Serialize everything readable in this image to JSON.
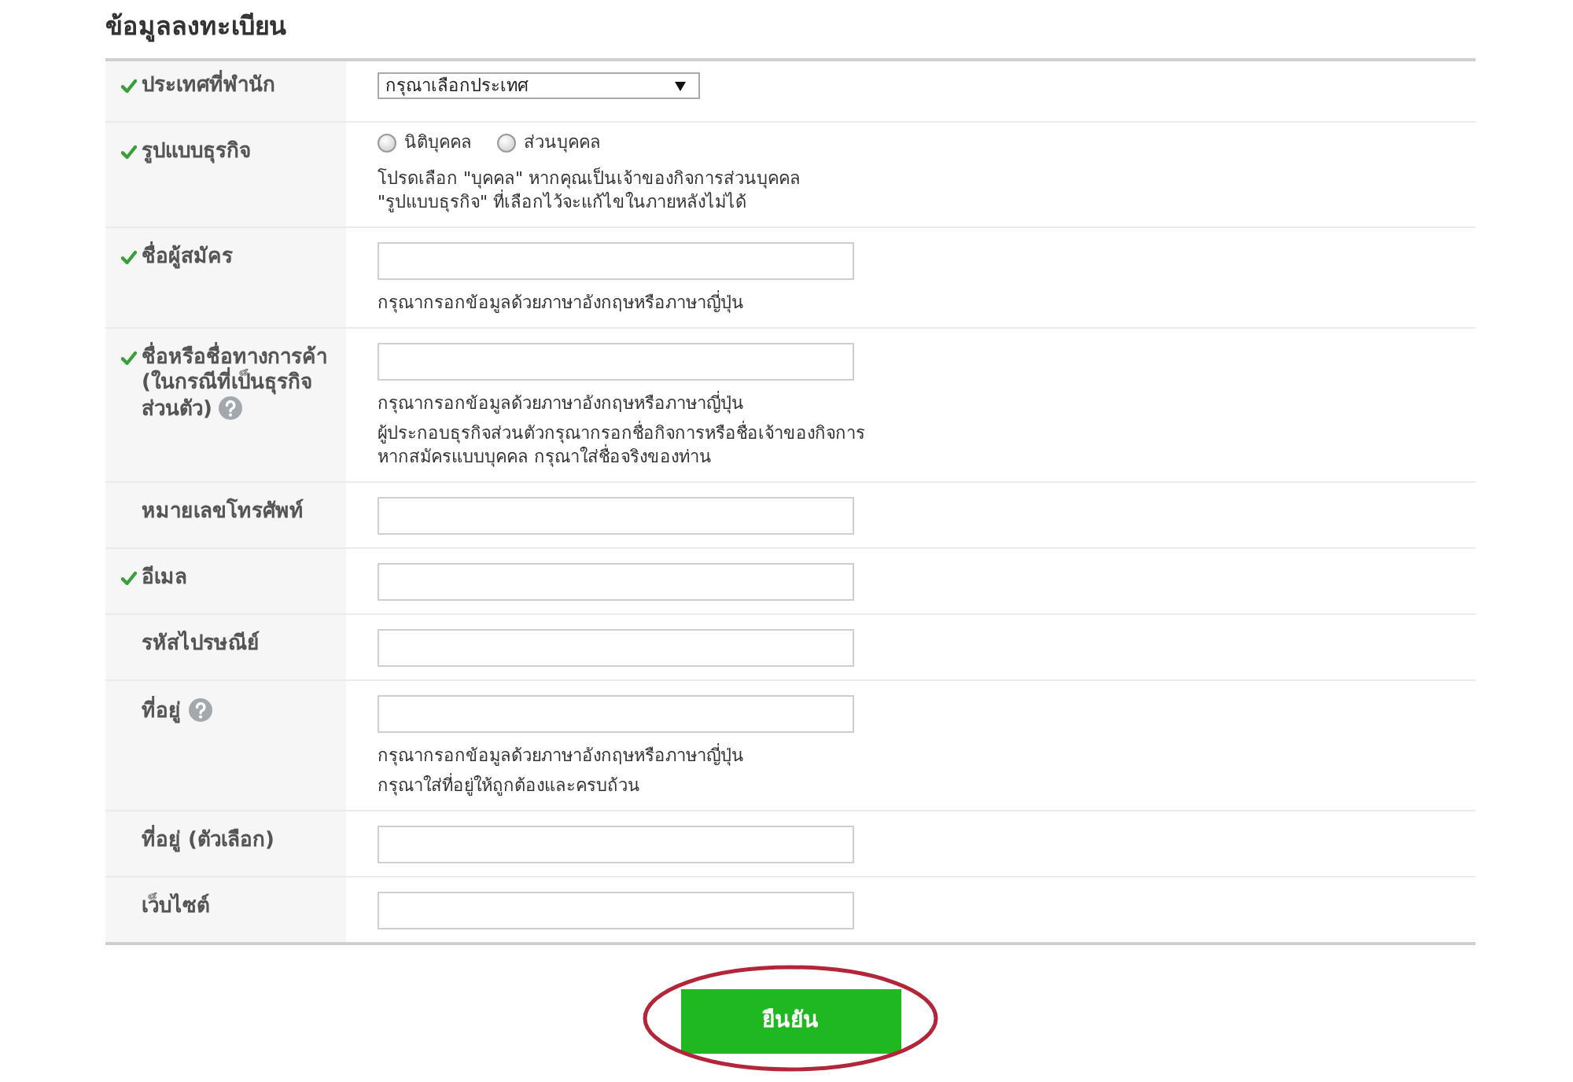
{
  "title": "ข้อมูลลงทะเบียน",
  "fields": [
    {
      "kind": "select",
      "label": "ประเทศที่พำนัก",
      "required": true,
      "help": false,
      "value": "กรุณาเลือกประเทศ"
    },
    {
      "kind": "radio",
      "label": "รูปแบบธุรกิจ",
      "required": true,
      "help": false,
      "options": [
        {
          "label": "นิติบุคคล",
          "selected": false
        },
        {
          "label": "ส่วนบุคคล",
          "selected": false
        }
      ],
      "notes": [
        [
          "โปรดเลือก \"บุคคล\" หากคุณเป็นเจ้าของกิจการส่วนบุคคล",
          "\"รูปแบบธุรกิจ\" ที่เลือกไว้จะแก้ไขในภายหลังไม่ได้"
        ]
      ]
    },
    {
      "kind": "text",
      "label": "ชื่อผู้สมัคร",
      "required": true,
      "help": false,
      "notes": [
        [
          "กรุณากรอกข้อมูลด้วยภาษาอังกฤษหรือภาษาญี่ปุ่น"
        ]
      ]
    },
    {
      "kind": "text",
      "label": "ชื่อหรือชื่อทางการค้า (ในกรณีที่เป็นธุรกิจส่วนตัว)",
      "required": true,
      "help": true,
      "notes": [
        [
          "กรุณากรอกข้อมูลด้วยภาษาอังกฤษหรือภาษาญี่ปุ่น"
        ],
        [
          "ผู้ประกอบธุรกิจส่วนตัวกรุณากรอกชื่อกิจการหรือชื่อเจ้าของกิจการ",
          "หากสมัครแบบบุคคล กรุณาใส่ชื่อจริงของท่าน"
        ]
      ]
    },
    {
      "kind": "text",
      "label": "หมายเลขโทรศัพท์",
      "required": false,
      "help": false
    },
    {
      "kind": "text",
      "label": "อีเมล",
      "required": true,
      "help": false
    },
    {
      "kind": "text",
      "label": "รหัสไปรษณีย์",
      "required": false,
      "help": false
    },
    {
      "kind": "text",
      "label": "ที่อยู่",
      "required": false,
      "help": true,
      "notes": [
        [
          "กรุณากรอกข้อมูลด้วยภาษาอังกฤษหรือภาษาญี่ปุ่น"
        ],
        [
          "กรุณาใส่ที่อยู่ให้ถูกต้องและครบถ้วน"
        ]
      ]
    },
    {
      "kind": "text",
      "label": "ที่อยู่ (ตัวเลือก)",
      "required": false,
      "help": false
    },
    {
      "kind": "text",
      "label": "เว็บไซต์",
      "required": false,
      "help": false
    }
  ],
  "submit": "ยืนยัน"
}
